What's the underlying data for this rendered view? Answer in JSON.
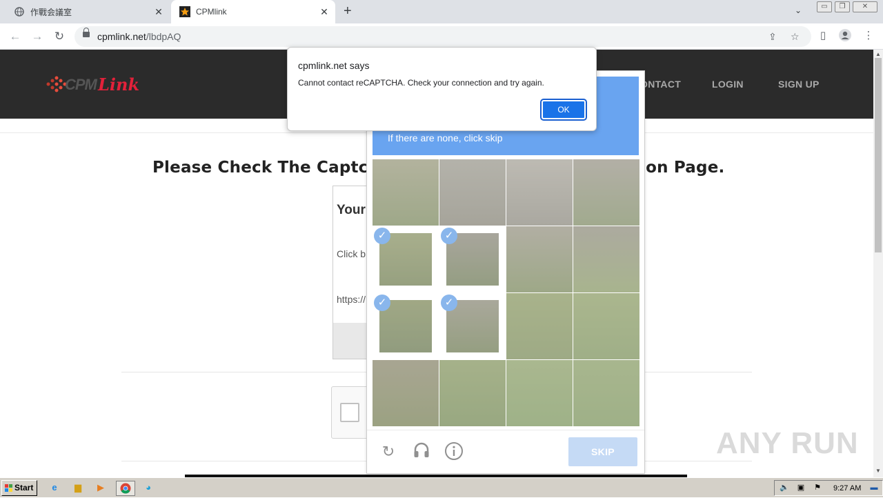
{
  "browser": {
    "tabs": [
      {
        "title": "作戰会議室",
        "active": false
      },
      {
        "title": "CPMlink",
        "active": true
      }
    ],
    "url_host": "cpmlink.net",
    "url_path": "/lbdpAQ"
  },
  "site": {
    "logo_text_1": "CPM",
    "logo_text_2": "Link",
    "nav": [
      "CONTACT",
      "LOGIN",
      "SIGN UP"
    ],
    "nav_visible": [
      "ONTACT",
      "LOGIN",
      "SIGN UP"
    ],
    "headline_left": "Please Check The Captcha",
    "headline_right": "ion Page.",
    "card_title": "Your",
    "card_text": "Click b",
    "card_url": "https://"
  },
  "recaptcha": {
    "instruction": "If there are none, click skip",
    "skip_label": "SKIP",
    "tiles": [
      {
        "row": 0,
        "col": 0,
        "selected": false
      },
      {
        "row": 0,
        "col": 1,
        "selected": false
      },
      {
        "row": 0,
        "col": 2,
        "selected": false
      },
      {
        "row": 0,
        "col": 3,
        "selected": false
      },
      {
        "row": 1,
        "col": 0,
        "selected": true
      },
      {
        "row": 1,
        "col": 1,
        "selected": true
      },
      {
        "row": 1,
        "col": 2,
        "selected": false
      },
      {
        "row": 1,
        "col": 3,
        "selected": false
      },
      {
        "row": 2,
        "col": 0,
        "selected": true
      },
      {
        "row": 2,
        "col": 1,
        "selected": true
      },
      {
        "row": 2,
        "col": 2,
        "selected": false
      },
      {
        "row": 2,
        "col": 3,
        "selected": false
      },
      {
        "row": 3,
        "col": 0,
        "selected": false
      },
      {
        "row": 3,
        "col": 1,
        "selected": false
      },
      {
        "row": 3,
        "col": 2,
        "selected": false
      },
      {
        "row": 3,
        "col": 3,
        "selected": false
      }
    ]
  },
  "alert": {
    "title": "cpmlink.net says",
    "message": "Cannot contact reCAPTCHA. Check your connection and try again.",
    "ok_label": "OK"
  },
  "watermark": "ANY RUN",
  "taskbar": {
    "start_label": "Start",
    "clock": "9:27 AM"
  },
  "colors": {
    "header_bg": "#2b2b2b",
    "brand_red": "#e3213a",
    "recaptcha_blue": "#1a73e8",
    "skip_disabled": "#a7c7f0"
  }
}
